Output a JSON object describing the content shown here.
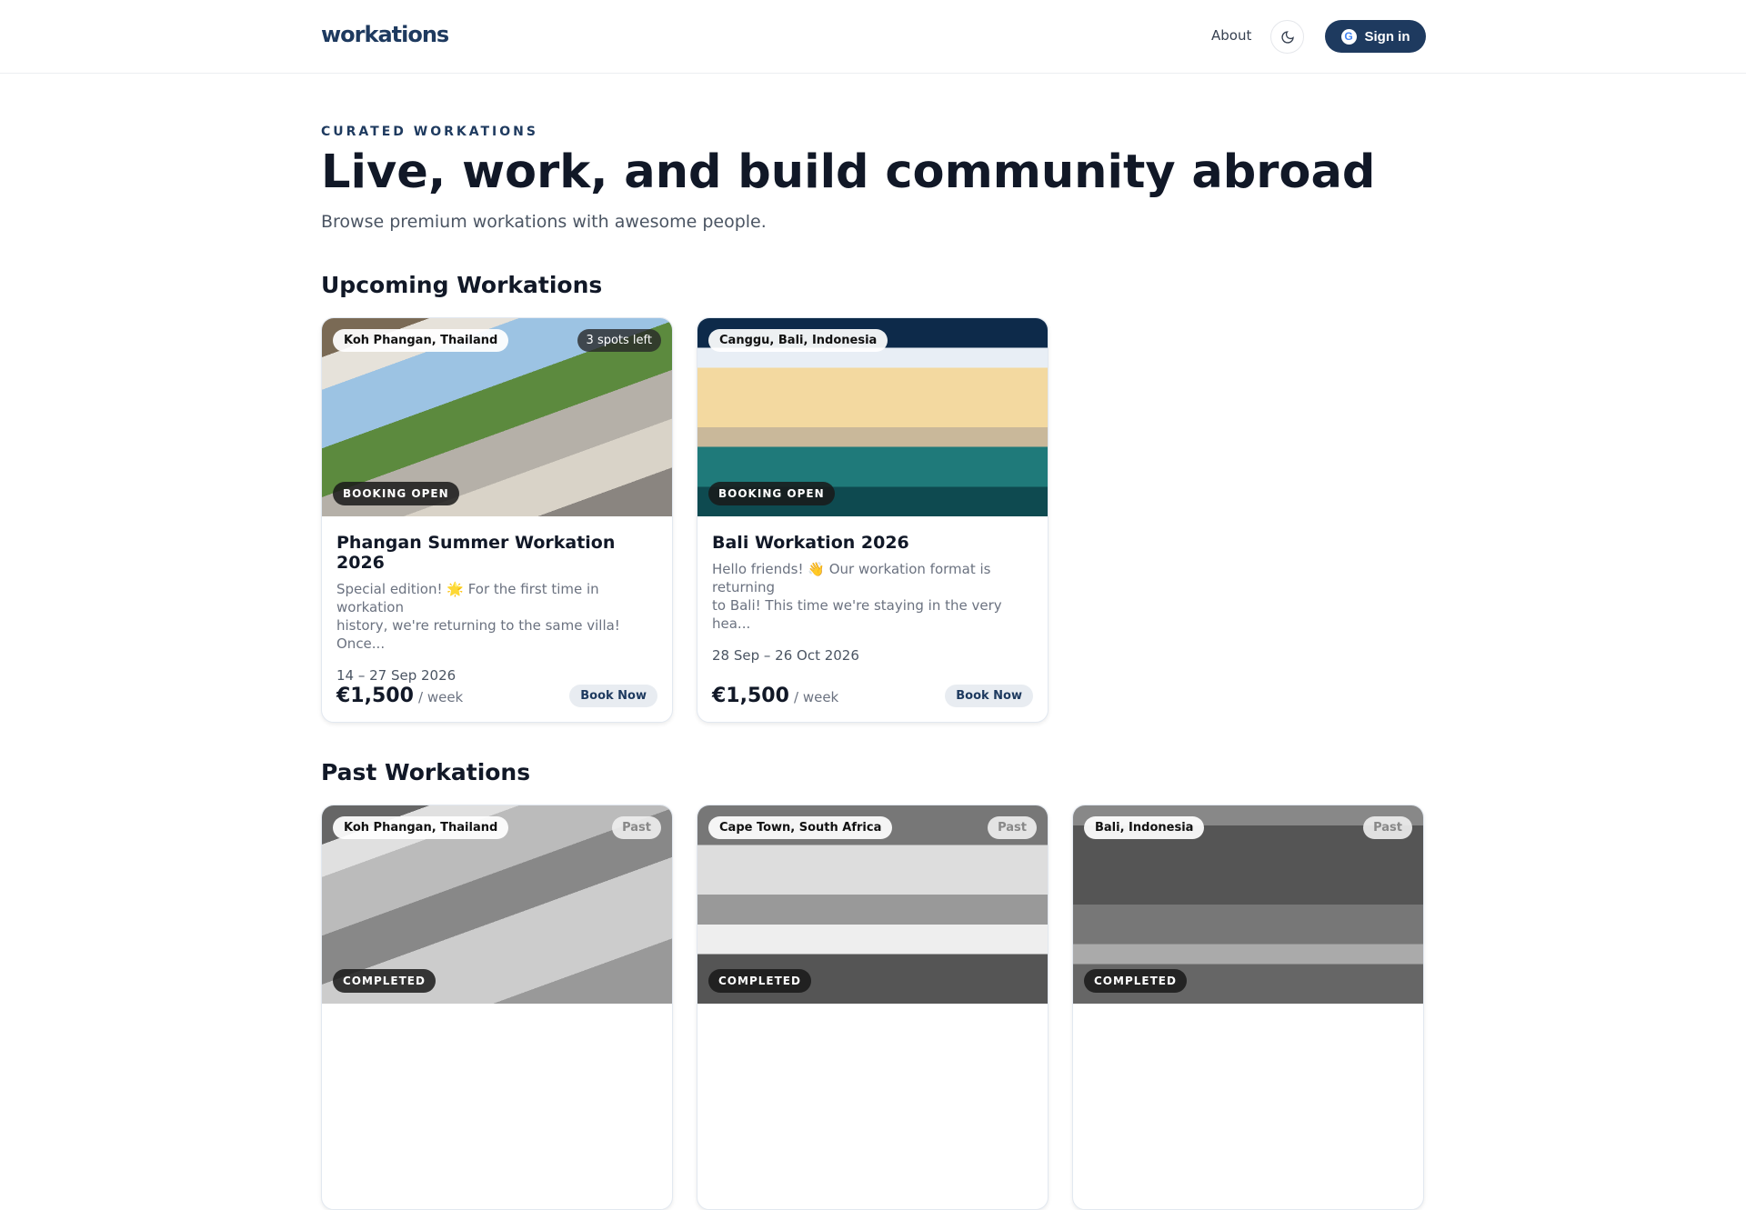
{
  "header": {
    "logo": "workations",
    "about": "About",
    "theme_icon": "moon-icon",
    "signin": "Sign in",
    "google_g": "G"
  },
  "hero": {
    "eyebrow": "CURATED WORKATIONS",
    "title": "Live, work, and build community abroad",
    "subtitle": "Browse premium workations with awesome people."
  },
  "upcoming": {
    "heading": "Upcoming Workations",
    "cards": [
      {
        "location": "Koh Phangan, Thailand",
        "spots": "3 spots left",
        "status": "BOOKING OPEN",
        "title": "Phangan Summer Workation 2026",
        "desc_1": "Special edition! 🌟 For the first time in workation",
        "desc_2": "history, we're returning to the same villa! Once...",
        "dates": "14 – 27 Sep 2026",
        "price": "€1,500",
        "per": "/ week",
        "cta": "Book Now"
      },
      {
        "location": "Canggu, Bali, Indonesia",
        "status": "BOOKING OPEN",
        "title": "Bali Workation 2026",
        "desc_1": "Hello friends! 👋 Our workation format is returning",
        "desc_2": "to Bali! This time we're staying in the very hea...",
        "dates": "28 Sep – 26 Oct 2026",
        "price": "€1,500",
        "per": "/ week",
        "cta": "Book Now"
      }
    ]
  },
  "past": {
    "heading": "Past Workations",
    "cards": [
      {
        "location": "Koh Phangan, Thailand",
        "badge": "Past",
        "status": "COMPLETED"
      },
      {
        "location": "Cape Town, South Africa",
        "badge": "Past",
        "status": "COMPLETED"
      },
      {
        "location": "Bali, Indonesia",
        "badge": "Past",
        "status": "COMPLETED"
      }
    ]
  }
}
